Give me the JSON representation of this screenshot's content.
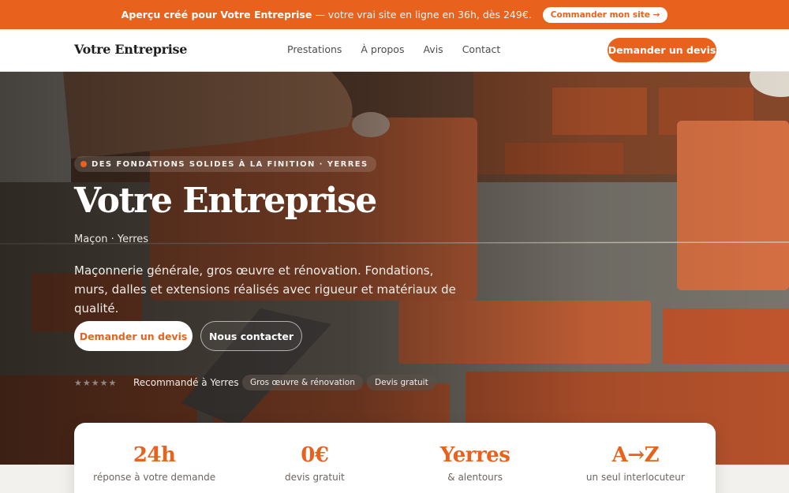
{
  "promo": {
    "bold": "Aperçu créé pour Votre Entreprise",
    "text": " — votre vrai site en ligne en 36h, dès 249€.",
    "button": "Commander mon site →"
  },
  "nav": {
    "brand": "Votre Entreprise",
    "links": [
      "Prestations",
      "À propos",
      "Avis",
      "Contact"
    ],
    "cta": "Demander un devis"
  },
  "hero": {
    "eyebrow": "DES FONDATIONS SOLIDES À LA FINITION · YERRES",
    "title": "Votre Entreprise",
    "subtitle": "Maçon · Yerres",
    "description": "Maçonnerie générale, gros œuvre et rénovation. Fondations, murs, dalles et extensions réalisés avec rigueur et matériaux de qualité.",
    "primary_button": "Demander un devis",
    "secondary_button": "Nous contacter",
    "stars": "★★★★★",
    "recommendation": "Recommandé à Yerres",
    "chips": [
      "Gros œuvre & rénovation",
      "Devis gratuit"
    ]
  },
  "stats": [
    {
      "value": "24h",
      "label": "réponse à votre demande"
    },
    {
      "value": "0€",
      "label": "devis gratuit"
    },
    {
      "value": "Yerres",
      "label": "& alentours"
    },
    {
      "value": "A→Z",
      "label": "un seul interlocuteur"
    }
  ],
  "colors": {
    "accent": "#e8621d",
    "brick": "#c8542a",
    "mortar": "#8c8a82"
  },
  "icons": {
    "rating": "star-icon"
  }
}
